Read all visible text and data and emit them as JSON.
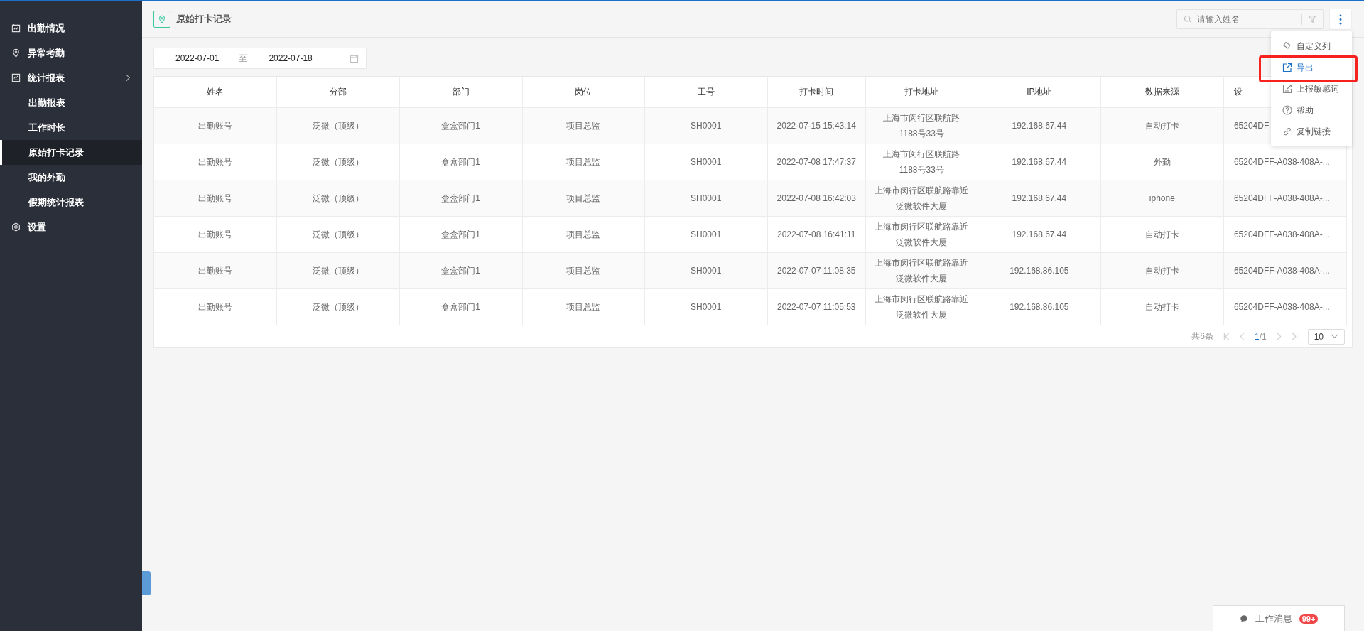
{
  "sidebar": {
    "items": [
      {
        "label": "出勤情况",
        "selected": false
      },
      {
        "label": "异常考勤",
        "selected": false
      },
      {
        "label": "统计报表",
        "selected": false,
        "children": [
          {
            "label": "出勤报表",
            "selected": false
          },
          {
            "label": "工作时长",
            "selected": false
          },
          {
            "label": "原始打卡记录",
            "selected": true
          },
          {
            "label": "我的外勤",
            "selected": false
          },
          {
            "label": "假期统计报表",
            "selected": false
          }
        ]
      },
      {
        "label": "设置",
        "selected": false
      }
    ]
  },
  "header": {
    "title": "原始打卡记录",
    "search": {
      "placeholder": "请输入姓名"
    }
  },
  "more_menu": {
    "items": [
      {
        "label": "自定义列",
        "selected": false
      },
      {
        "label": "导出",
        "selected": true
      },
      {
        "label": "上报敏感词",
        "selected": false
      },
      {
        "label": "帮助",
        "selected": false
      },
      {
        "label": "复制链接",
        "selected": false
      }
    ]
  },
  "date_range": {
    "start": "2022-07-01",
    "separator": "至",
    "end": "2022-07-18"
  },
  "table": {
    "columns": [
      "姓名",
      "分部",
      "部门",
      "岗位",
      "工号",
      "打卡时间",
      "打卡地址",
      "IP地址",
      "数据来源",
      "设"
    ],
    "rows": [
      {
        "cells": [
          "出勤账号",
          "泛微（顶级）",
          "盒盒部门1",
          "项目总监",
          "SH0001",
          "2022-07-15 15:43:14",
          "上海市闵行区联航路\n1188号33号",
          "192.168.67.44",
          "自动打卡",
          "65204DF"
        ]
      },
      {
        "cells": [
          "出勤账号",
          "泛微（顶级）",
          "盒盒部门1",
          "项目总监",
          "SH0001",
          "2022-07-08 17:47:37",
          "上海市闵行区联航路\n1188号33号",
          "192.168.67.44",
          "外勤",
          "65204DFF-A038-408A-..."
        ]
      },
      {
        "cells": [
          "出勤账号",
          "泛微（顶级）",
          "盒盒部门1",
          "项目总监",
          "SH0001",
          "2022-07-08 16:42:03",
          "上海市闵行区联航路靠近泛微软件大厦",
          "192.168.67.44",
          "iphone",
          "65204DFF-A038-408A-..."
        ]
      },
      {
        "cells": [
          "出勤账号",
          "泛微（顶级）",
          "盒盒部门1",
          "项目总监",
          "SH0001",
          "2022-07-08 16:41:11",
          "上海市闵行区联航路靠近泛微软件大厦",
          "192.168.67.44",
          "自动打卡",
          "65204DFF-A038-408A-..."
        ]
      },
      {
        "cells": [
          "出勤账号",
          "泛微（顶级）",
          "盒盒部门1",
          "项目总监",
          "SH0001",
          "2022-07-07 11:08:35",
          "上海市闵行区联航路靠近泛微软件大厦",
          "192.168.86.105",
          "自动打卡",
          "65204DFF-A038-408A-..."
        ]
      },
      {
        "cells": [
          "出勤账号",
          "泛微（顶级）",
          "盒盒部门1",
          "项目总监",
          "SH0001",
          "2022-07-07 11:05:53",
          "上海市闵行区联航路靠近泛微软件大厦",
          "192.168.86.105",
          "自动打卡",
          "65204DFF-A038-408A-..."
        ]
      }
    ]
  },
  "pagination": {
    "total": "共6条",
    "current": "1",
    "pages": "/1",
    "page_size": "10"
  },
  "messages": {
    "label": "工作消息",
    "badge": "99+"
  }
}
